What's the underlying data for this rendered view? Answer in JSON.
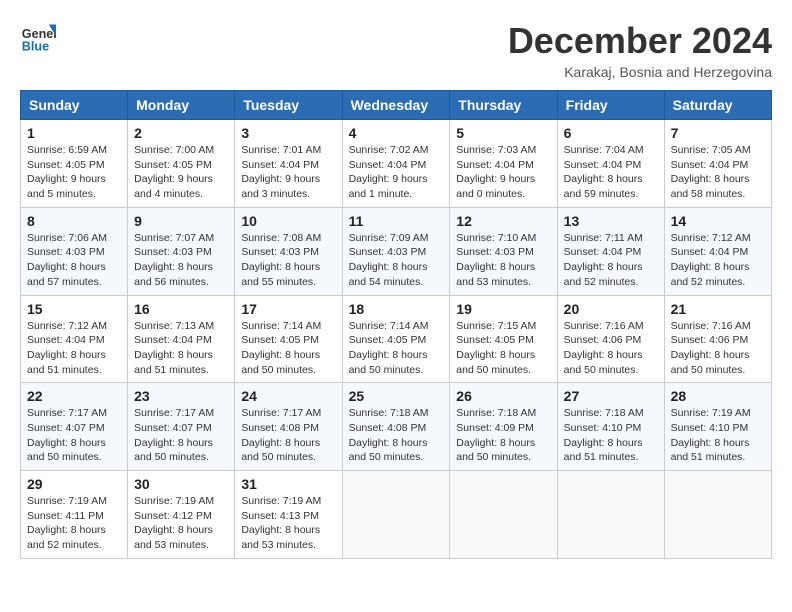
{
  "logo": {
    "line1": "General",
    "line2": "Blue"
  },
  "title": "December 2024",
  "location": "Karakaj, Bosnia and Herzegovina",
  "headers": [
    "Sunday",
    "Monday",
    "Tuesday",
    "Wednesday",
    "Thursday",
    "Friday",
    "Saturday"
  ],
  "weeks": [
    [
      {
        "day": "1",
        "sunrise": "Sunrise: 6:59 AM",
        "sunset": "Sunset: 4:05 PM",
        "daylight": "Daylight: 9 hours and 5 minutes."
      },
      {
        "day": "2",
        "sunrise": "Sunrise: 7:00 AM",
        "sunset": "Sunset: 4:05 PM",
        "daylight": "Daylight: 9 hours and 4 minutes."
      },
      {
        "day": "3",
        "sunrise": "Sunrise: 7:01 AM",
        "sunset": "Sunset: 4:04 PM",
        "daylight": "Daylight: 9 hours and 3 minutes."
      },
      {
        "day": "4",
        "sunrise": "Sunrise: 7:02 AM",
        "sunset": "Sunset: 4:04 PM",
        "daylight": "Daylight: 9 hours and 1 minute."
      },
      {
        "day": "5",
        "sunrise": "Sunrise: 7:03 AM",
        "sunset": "Sunset: 4:04 PM",
        "daylight": "Daylight: 9 hours and 0 minutes."
      },
      {
        "day": "6",
        "sunrise": "Sunrise: 7:04 AM",
        "sunset": "Sunset: 4:04 PM",
        "daylight": "Daylight: 8 hours and 59 minutes."
      },
      {
        "day": "7",
        "sunrise": "Sunrise: 7:05 AM",
        "sunset": "Sunset: 4:04 PM",
        "daylight": "Daylight: 8 hours and 58 minutes."
      }
    ],
    [
      {
        "day": "8",
        "sunrise": "Sunrise: 7:06 AM",
        "sunset": "Sunset: 4:03 PM",
        "daylight": "Daylight: 8 hours and 57 minutes."
      },
      {
        "day": "9",
        "sunrise": "Sunrise: 7:07 AM",
        "sunset": "Sunset: 4:03 PM",
        "daylight": "Daylight: 8 hours and 56 minutes."
      },
      {
        "day": "10",
        "sunrise": "Sunrise: 7:08 AM",
        "sunset": "Sunset: 4:03 PM",
        "daylight": "Daylight: 8 hours and 55 minutes."
      },
      {
        "day": "11",
        "sunrise": "Sunrise: 7:09 AM",
        "sunset": "Sunset: 4:03 PM",
        "daylight": "Daylight: 8 hours and 54 minutes."
      },
      {
        "day": "12",
        "sunrise": "Sunrise: 7:10 AM",
        "sunset": "Sunset: 4:03 PM",
        "daylight": "Daylight: 8 hours and 53 minutes."
      },
      {
        "day": "13",
        "sunrise": "Sunrise: 7:11 AM",
        "sunset": "Sunset: 4:04 PM",
        "daylight": "Daylight: 8 hours and 52 minutes."
      },
      {
        "day": "14",
        "sunrise": "Sunrise: 7:12 AM",
        "sunset": "Sunset: 4:04 PM",
        "daylight": "Daylight: 8 hours and 52 minutes."
      }
    ],
    [
      {
        "day": "15",
        "sunrise": "Sunrise: 7:12 AM",
        "sunset": "Sunset: 4:04 PM",
        "daylight": "Daylight: 8 hours and 51 minutes."
      },
      {
        "day": "16",
        "sunrise": "Sunrise: 7:13 AM",
        "sunset": "Sunset: 4:04 PM",
        "daylight": "Daylight: 8 hours and 51 minutes."
      },
      {
        "day": "17",
        "sunrise": "Sunrise: 7:14 AM",
        "sunset": "Sunset: 4:05 PM",
        "daylight": "Daylight: 8 hours and 50 minutes."
      },
      {
        "day": "18",
        "sunrise": "Sunrise: 7:14 AM",
        "sunset": "Sunset: 4:05 PM",
        "daylight": "Daylight: 8 hours and 50 minutes."
      },
      {
        "day": "19",
        "sunrise": "Sunrise: 7:15 AM",
        "sunset": "Sunset: 4:05 PM",
        "daylight": "Daylight: 8 hours and 50 minutes."
      },
      {
        "day": "20",
        "sunrise": "Sunrise: 7:16 AM",
        "sunset": "Sunset: 4:06 PM",
        "daylight": "Daylight: 8 hours and 50 minutes."
      },
      {
        "day": "21",
        "sunrise": "Sunrise: 7:16 AM",
        "sunset": "Sunset: 4:06 PM",
        "daylight": "Daylight: 8 hours and 50 minutes."
      }
    ],
    [
      {
        "day": "22",
        "sunrise": "Sunrise: 7:17 AM",
        "sunset": "Sunset: 4:07 PM",
        "daylight": "Daylight: 8 hours and 50 minutes."
      },
      {
        "day": "23",
        "sunrise": "Sunrise: 7:17 AM",
        "sunset": "Sunset: 4:07 PM",
        "daylight": "Daylight: 8 hours and 50 minutes."
      },
      {
        "day": "24",
        "sunrise": "Sunrise: 7:17 AM",
        "sunset": "Sunset: 4:08 PM",
        "daylight": "Daylight: 8 hours and 50 minutes."
      },
      {
        "day": "25",
        "sunrise": "Sunrise: 7:18 AM",
        "sunset": "Sunset: 4:08 PM",
        "daylight": "Daylight: 8 hours and 50 minutes."
      },
      {
        "day": "26",
        "sunrise": "Sunrise: 7:18 AM",
        "sunset": "Sunset: 4:09 PM",
        "daylight": "Daylight: 8 hours and 50 minutes."
      },
      {
        "day": "27",
        "sunrise": "Sunrise: 7:18 AM",
        "sunset": "Sunset: 4:10 PM",
        "daylight": "Daylight: 8 hours and 51 minutes."
      },
      {
        "day": "28",
        "sunrise": "Sunrise: 7:19 AM",
        "sunset": "Sunset: 4:10 PM",
        "daylight": "Daylight: 8 hours and 51 minutes."
      }
    ],
    [
      {
        "day": "29",
        "sunrise": "Sunrise: 7:19 AM",
        "sunset": "Sunset: 4:11 PM",
        "daylight": "Daylight: 8 hours and 52 minutes."
      },
      {
        "day": "30",
        "sunrise": "Sunrise: 7:19 AM",
        "sunset": "Sunset: 4:12 PM",
        "daylight": "Daylight: 8 hours and 53 minutes."
      },
      {
        "day": "31",
        "sunrise": "Sunrise: 7:19 AM",
        "sunset": "Sunset: 4:13 PM",
        "daylight": "Daylight: 8 hours and 53 minutes."
      },
      null,
      null,
      null,
      null
    ]
  ]
}
